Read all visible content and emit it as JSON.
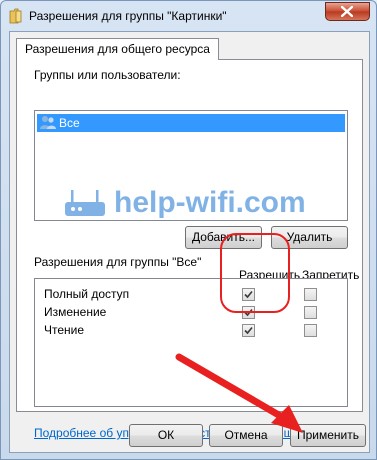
{
  "window": {
    "title": "Разрешения для группы \"Картинки\"",
    "icon": "folder-icon",
    "close_icon": "close-icon"
  },
  "tab": {
    "label": "Разрешения для общего ресурса"
  },
  "groups": {
    "label": "Группы или пользователи:",
    "items": [
      {
        "label": "Все",
        "icon": "users-icon",
        "selected": true
      }
    ],
    "add_button": "Добавить...",
    "remove_button": "Удалить"
  },
  "watermark": {
    "text": "help-wifi.com",
    "icon": "router-icon"
  },
  "permissions": {
    "label": "Разрешения для группы \"Все\"",
    "col_allow": "Разрешить",
    "col_deny": "Запретить",
    "rows": [
      {
        "name": "Полный доступ",
        "allow": true,
        "deny": false
      },
      {
        "name": "Изменение",
        "allow": true,
        "deny": false
      },
      {
        "name": "Чтение",
        "allow": true,
        "deny": false
      }
    ]
  },
  "link": {
    "text": "Подробнее об управлении доступом и разрешениях"
  },
  "footer": {
    "ok": "ОК",
    "cancel": "Отмена",
    "apply": "Применить"
  },
  "colors": {
    "selection": "#3399ff",
    "link": "#0066cc",
    "annotation": "#e82020"
  }
}
